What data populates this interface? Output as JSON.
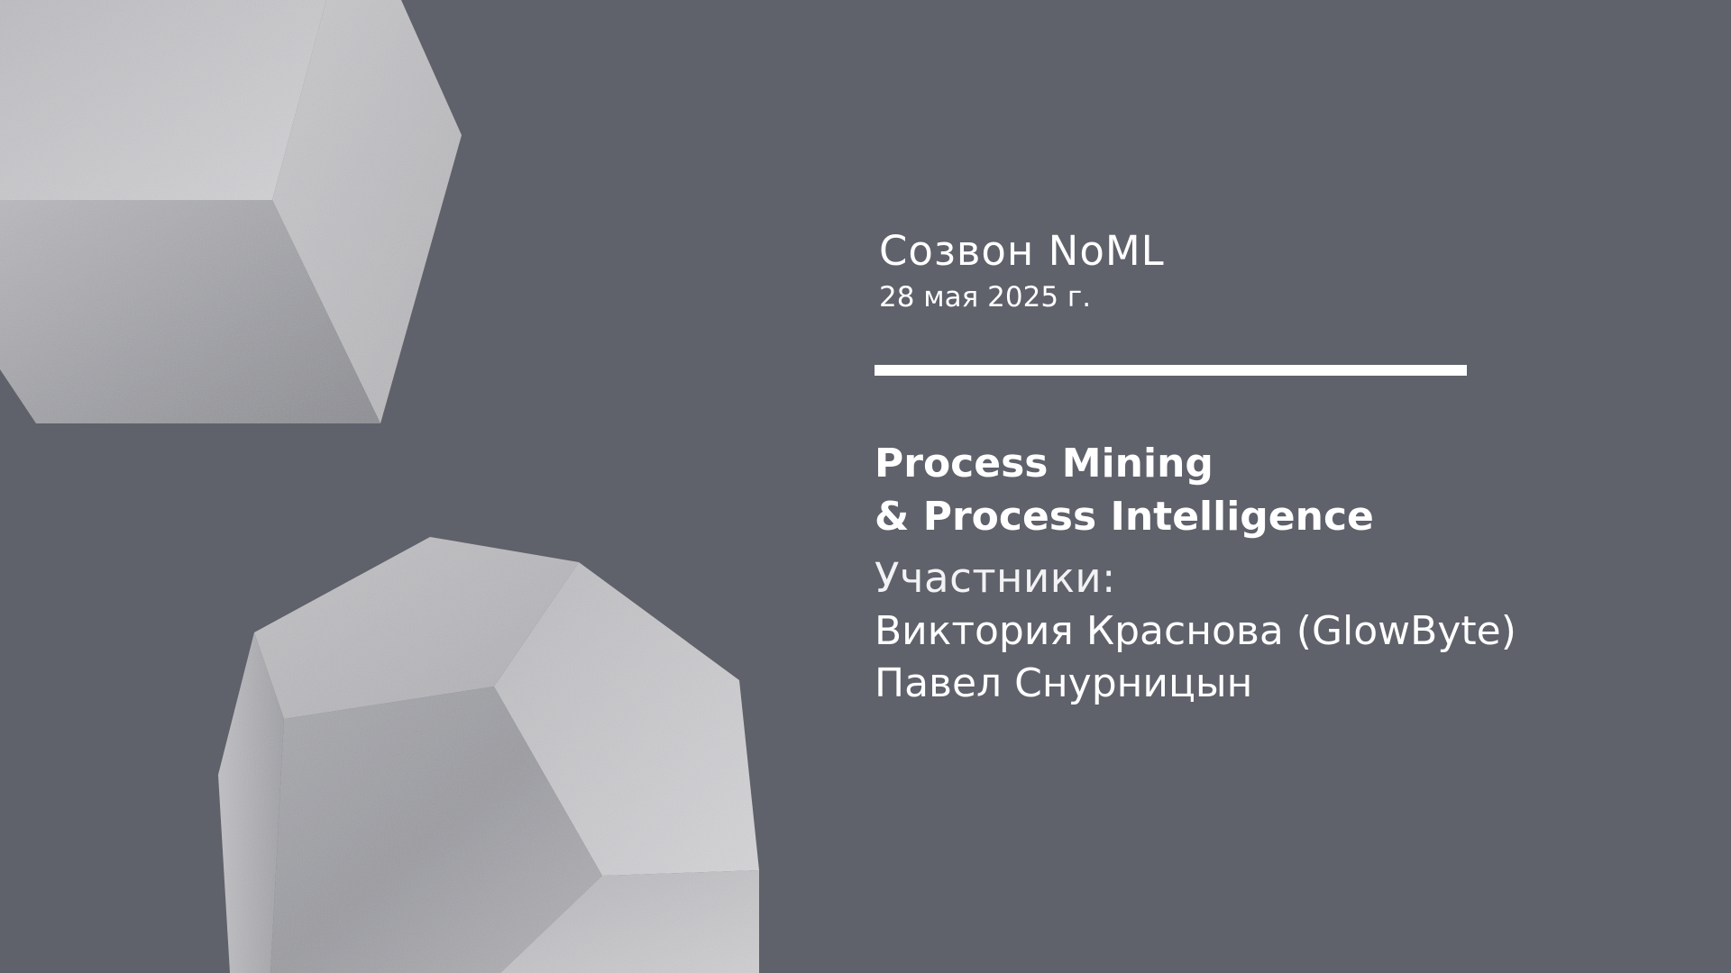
{
  "event": {
    "title": "Созвон NoML",
    "date": "28 мая 2025 г."
  },
  "talk": {
    "title_lines": [
      "Process Mining",
      "& Process Intelligence"
    ]
  },
  "participants": {
    "label": "Участники:",
    "names": [
      "Виктория Краснова (GlowByte)",
      "Павел Снурницын"
    ]
  },
  "colors": {
    "background": "#5f616b",
    "text": "#ffffff",
    "divider": "#ffffff",
    "shape_light": "#c8c8cc",
    "shape_dark": "#8b8c92"
  },
  "decorations": [
    "cube-shape",
    "dodecahedron-shape"
  ]
}
